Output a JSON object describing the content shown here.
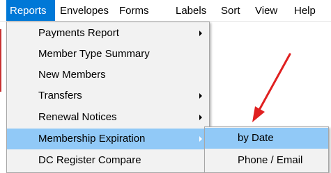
{
  "menubar": {
    "items": [
      {
        "label": "Reports",
        "active": true
      },
      {
        "label": "Envelopes",
        "active": false
      },
      {
        "label": "Forms",
        "active": false
      },
      {
        "label": "Labels",
        "active": false
      },
      {
        "label": "Sort",
        "active": false
      },
      {
        "label": "View",
        "active": false
      },
      {
        "label": "Help",
        "active": false
      }
    ]
  },
  "reports_menu": {
    "items": [
      {
        "label": "Payments Report",
        "has_submenu": true,
        "highlighted": false
      },
      {
        "label": "Member Type Summary",
        "has_submenu": false,
        "highlighted": false
      },
      {
        "label": "New Members",
        "has_submenu": false,
        "highlighted": false
      },
      {
        "label": "Transfers",
        "has_submenu": true,
        "highlighted": false
      },
      {
        "label": "Renewal Notices",
        "has_submenu": true,
        "highlighted": false
      },
      {
        "label": "Membership Expiration",
        "has_submenu": true,
        "highlighted": true
      },
      {
        "label": "DC Register Compare",
        "has_submenu": false,
        "highlighted": false
      }
    ]
  },
  "expiration_submenu": {
    "items": [
      {
        "label": "by Date",
        "highlighted": true
      },
      {
        "label": "Phone / Email",
        "highlighted": false
      }
    ]
  },
  "colors": {
    "menubar_active": "#0078d7",
    "menu_highlight": "#91c9f7",
    "menu_background": "#f2f2f2",
    "annotation_arrow": "#e02020"
  },
  "annotation": {
    "icon": "red-pointer-arrow-icon"
  }
}
